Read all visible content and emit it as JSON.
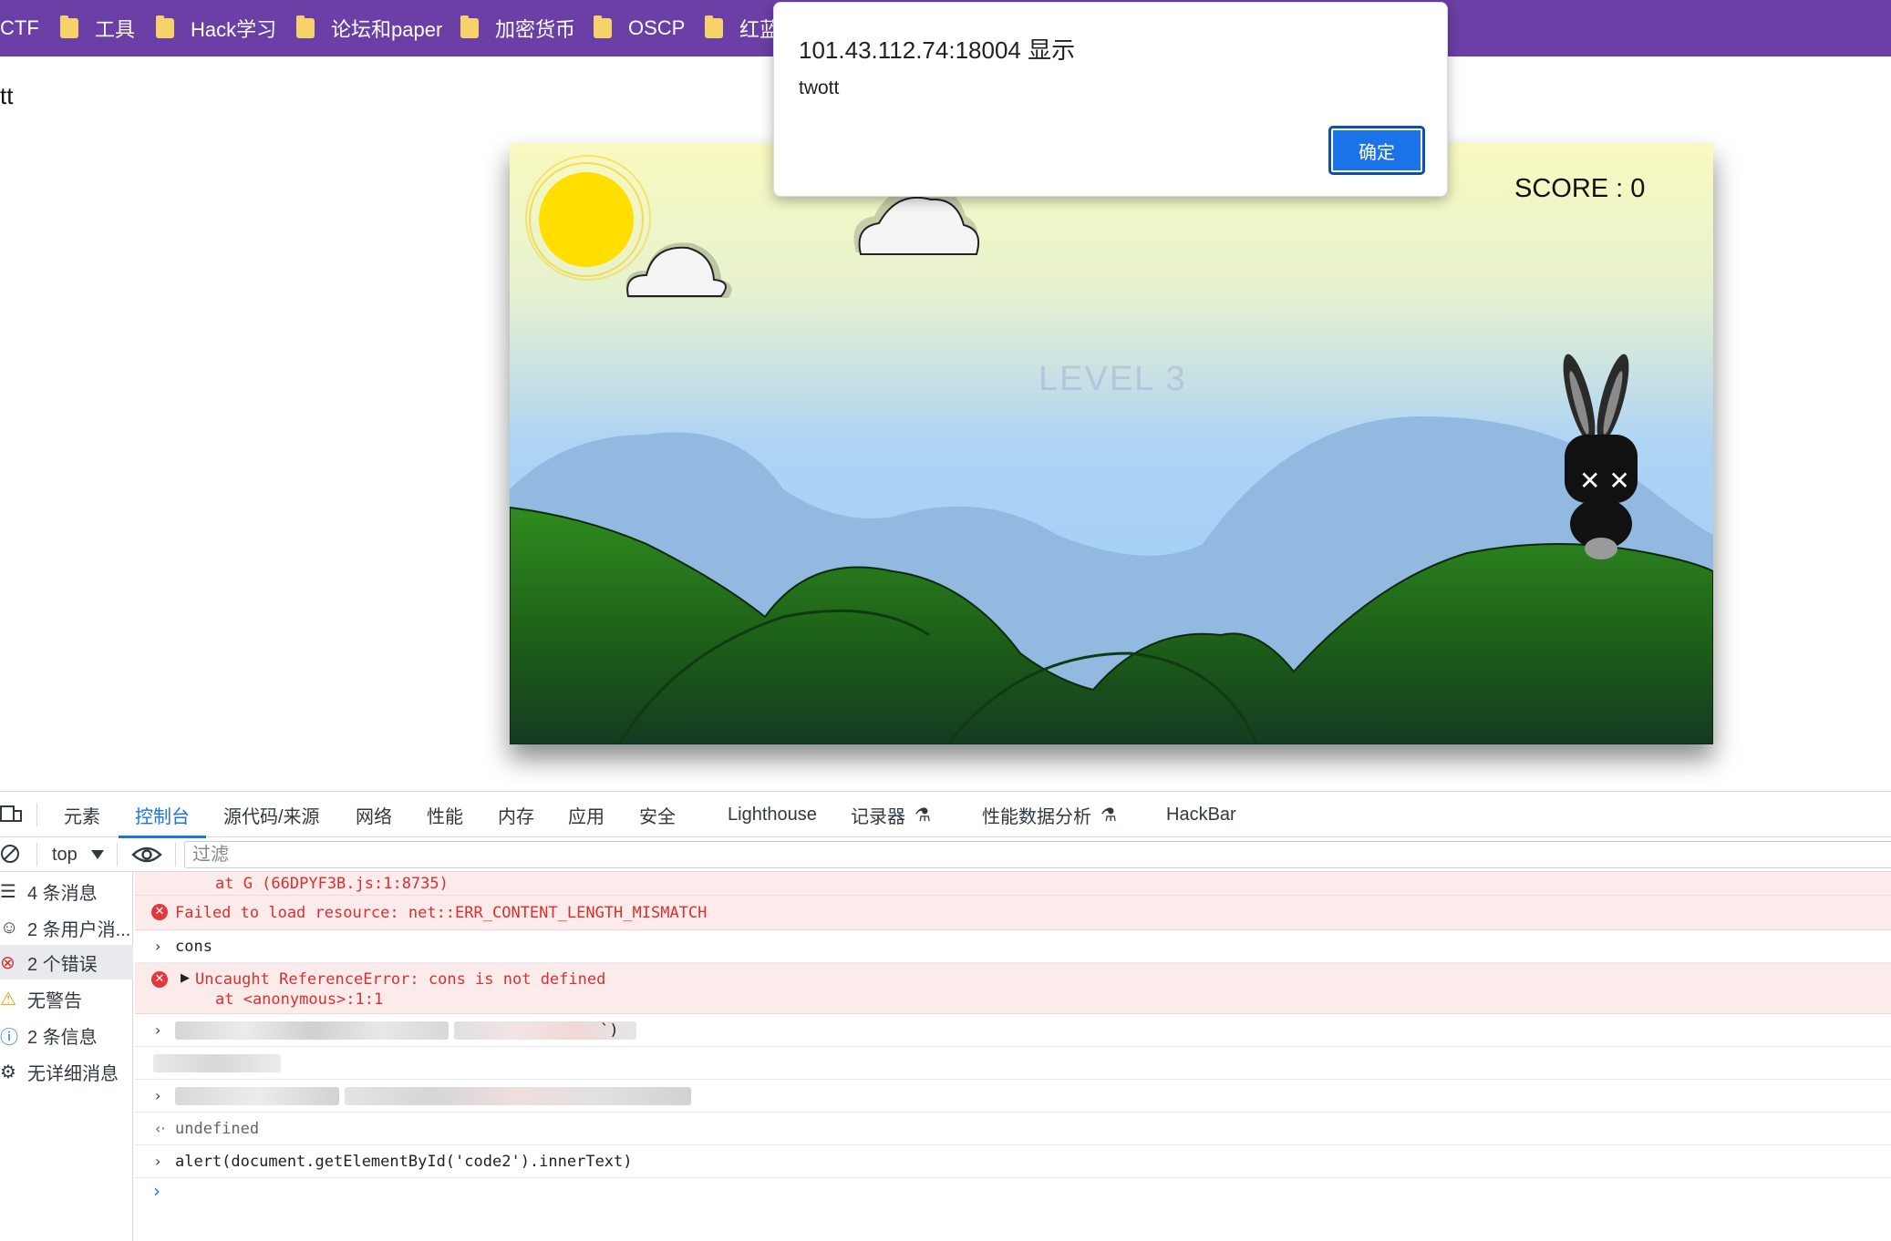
{
  "bookmarks": [
    "CTF",
    "工具",
    "Hack学习",
    "论坛和paper",
    "加密货币",
    "OSCP",
    "红蓝"
  ],
  "page": {
    "text": "tt"
  },
  "game": {
    "score_label": "SCORE : 0",
    "level_text": "LEVEL 3"
  },
  "alert": {
    "title": "101.43.112.74:18004 显示",
    "message": "twott",
    "ok_label": "确定"
  },
  "devtools": {
    "tabs": [
      "元素",
      "控制台",
      "源代码/来源",
      "网络",
      "性能",
      "内存",
      "应用",
      "安全",
      "Lighthouse",
      "记录器",
      "性能数据分析",
      "HackBar"
    ],
    "active_tab": "控制台",
    "context": "top",
    "filter_placeholder": "过滤",
    "sidebar": [
      {
        "icon": "list-icon",
        "label": "4 条消息"
      },
      {
        "icon": "user-icon",
        "label": "2 条用户消..."
      },
      {
        "icon": "error-icon",
        "label": "2 个错误"
      },
      {
        "icon": "warning-icon",
        "label": "无警告"
      },
      {
        "icon": "info-icon",
        "label": "2 条信息"
      },
      {
        "icon": "verbose-icon",
        "label": "无详细消息"
      }
    ],
    "console": {
      "stack_line": "at G (66DPYF3B.js:1:8735)",
      "error1": "Failed to load resource: net::ERR_CONTENT_LENGTH_MISMATCH",
      "input1": "cons",
      "error2": "Uncaught ReferenceError: cons is not defined",
      "error2_at": "at <anonymous>:1:1",
      "redacted_tail": "`)",
      "result": "undefined",
      "input_last": "alert(document.getElementById('code2').innerText)"
    }
  },
  "colors": {
    "bookmark_bar": "#6b3fa6",
    "accent": "#1a73e8",
    "error": "#d9302f"
  }
}
